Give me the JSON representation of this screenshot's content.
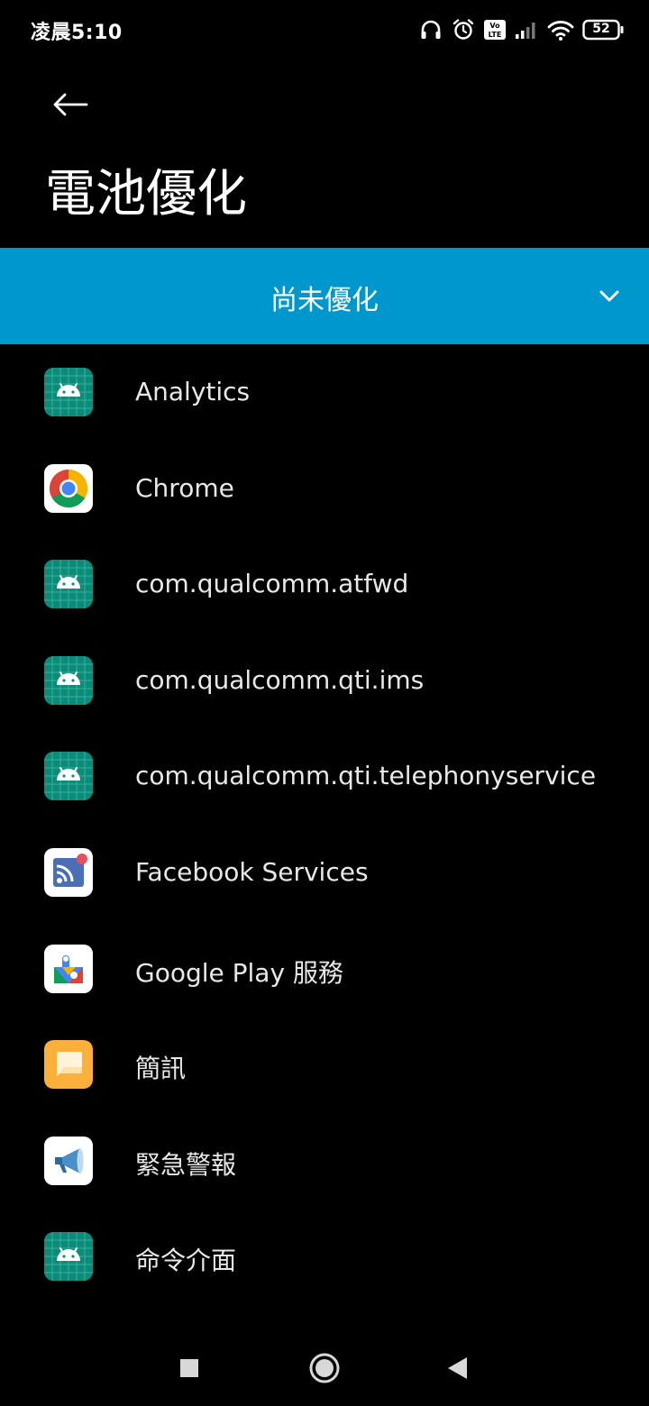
{
  "status_bar": {
    "time": "凌晨5:10",
    "battery": "52",
    "volte": "Vo LTE",
    "icons": [
      "headphones-icon",
      "alarm-icon",
      "volte-icon",
      "signal-icon",
      "wifi-icon",
      "battery-icon"
    ]
  },
  "header": {
    "back_icon": "arrow-left-icon",
    "title": "電池優化"
  },
  "filter": {
    "label": "尚未優化",
    "icon": "chevron-down-icon",
    "bg_color": "#0098cc"
  },
  "apps": [
    {
      "name": "Analytics",
      "icon": "android-icon"
    },
    {
      "name": "Chrome",
      "icon": "chrome-icon"
    },
    {
      "name": "com.qualcomm.atfwd",
      "icon": "android-icon"
    },
    {
      "name": "com.qualcomm.qti.ims",
      "icon": "android-icon"
    },
    {
      "name": "com.qualcomm.qti.telephonyservice",
      "icon": "android-icon"
    },
    {
      "name": "Facebook Services",
      "icon": "facebook-services-icon"
    },
    {
      "name": "Google Play 服務",
      "icon": "google-play-services-icon"
    },
    {
      "name": "簡訊",
      "icon": "messages-icon"
    },
    {
      "name": "緊急警報",
      "icon": "megaphone-icon"
    },
    {
      "name": "命令介面",
      "icon": "android-icon"
    }
  ],
  "nav_bar": {
    "recents_icon": "square-icon",
    "home_icon": "circle-icon",
    "back_icon": "triangle-back-icon"
  },
  "colors": {
    "android_teal": "#0e8a78",
    "accent": "#0098cc"
  }
}
